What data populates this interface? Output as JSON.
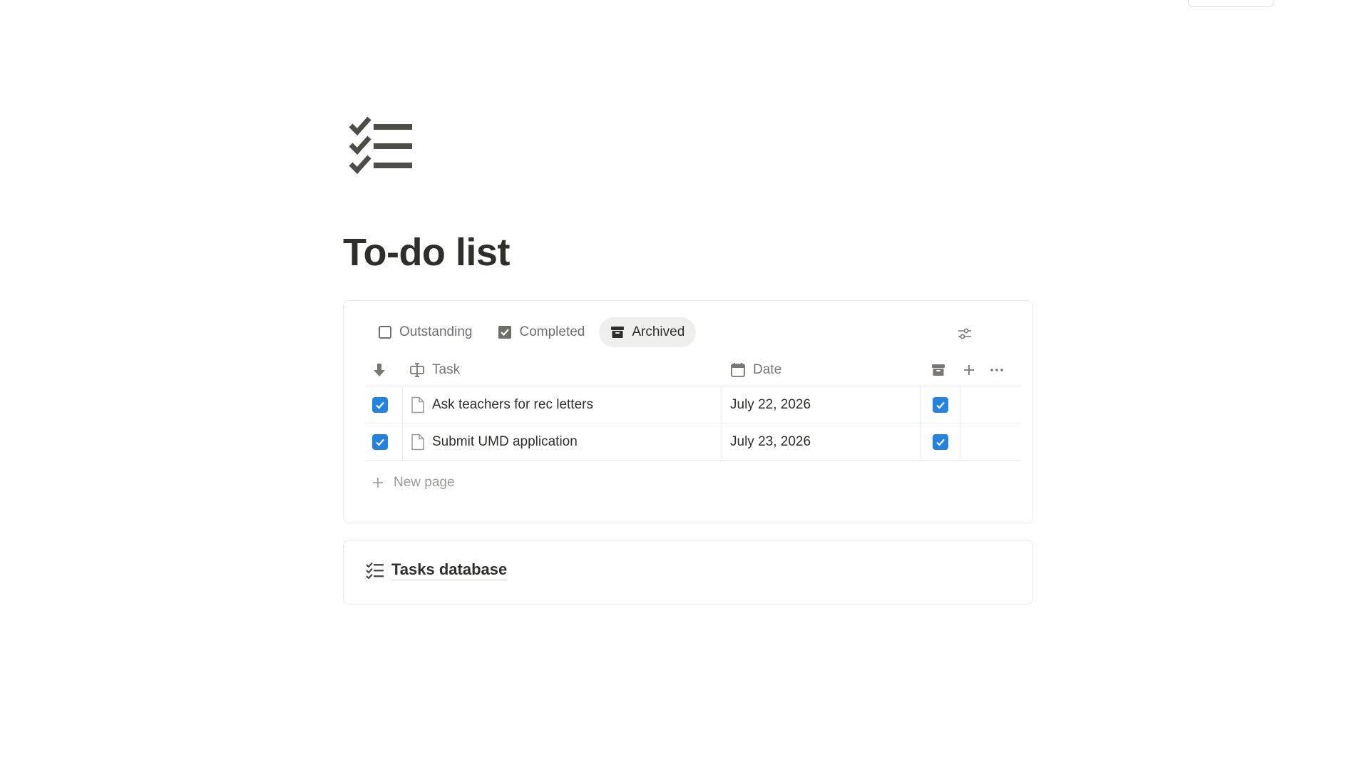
{
  "page": {
    "icon": "checklist-icon",
    "title": "To-do list"
  },
  "views": {
    "tabs": [
      {
        "label": "Outstanding",
        "icon": "checkbox-empty-icon",
        "active": false
      },
      {
        "label": "Completed",
        "icon": "checkbox-checked-icon",
        "active": false
      },
      {
        "label": "Archived",
        "icon": "archive-box-icon",
        "active": true
      }
    ],
    "settings_icon": "sliders-icon"
  },
  "table": {
    "columns": [
      {
        "label": "",
        "icon": "arrow-down-icon"
      },
      {
        "label": "Task",
        "icon": "text-cursor-icon"
      },
      {
        "label": "Date",
        "icon": "calendar-icon"
      },
      {
        "label": "",
        "icon": "archive-box-icon"
      }
    ],
    "rows": [
      {
        "done": true,
        "task": "Ask teachers for rec letters",
        "date": "July 22, 2026",
        "archived": true
      },
      {
        "done": true,
        "task": "Submit UMD application",
        "date": "July 23, 2026",
        "archived": true
      }
    ],
    "new_page_label": "New page"
  },
  "linked_db": {
    "label": "Tasks database",
    "icon": "checklist-icon"
  },
  "colors": {
    "accent": "#2383e2",
    "text": "#37352f",
    "muted": "#787774",
    "active_tab_bg": "#efefed",
    "border": "#e9e9e7"
  }
}
